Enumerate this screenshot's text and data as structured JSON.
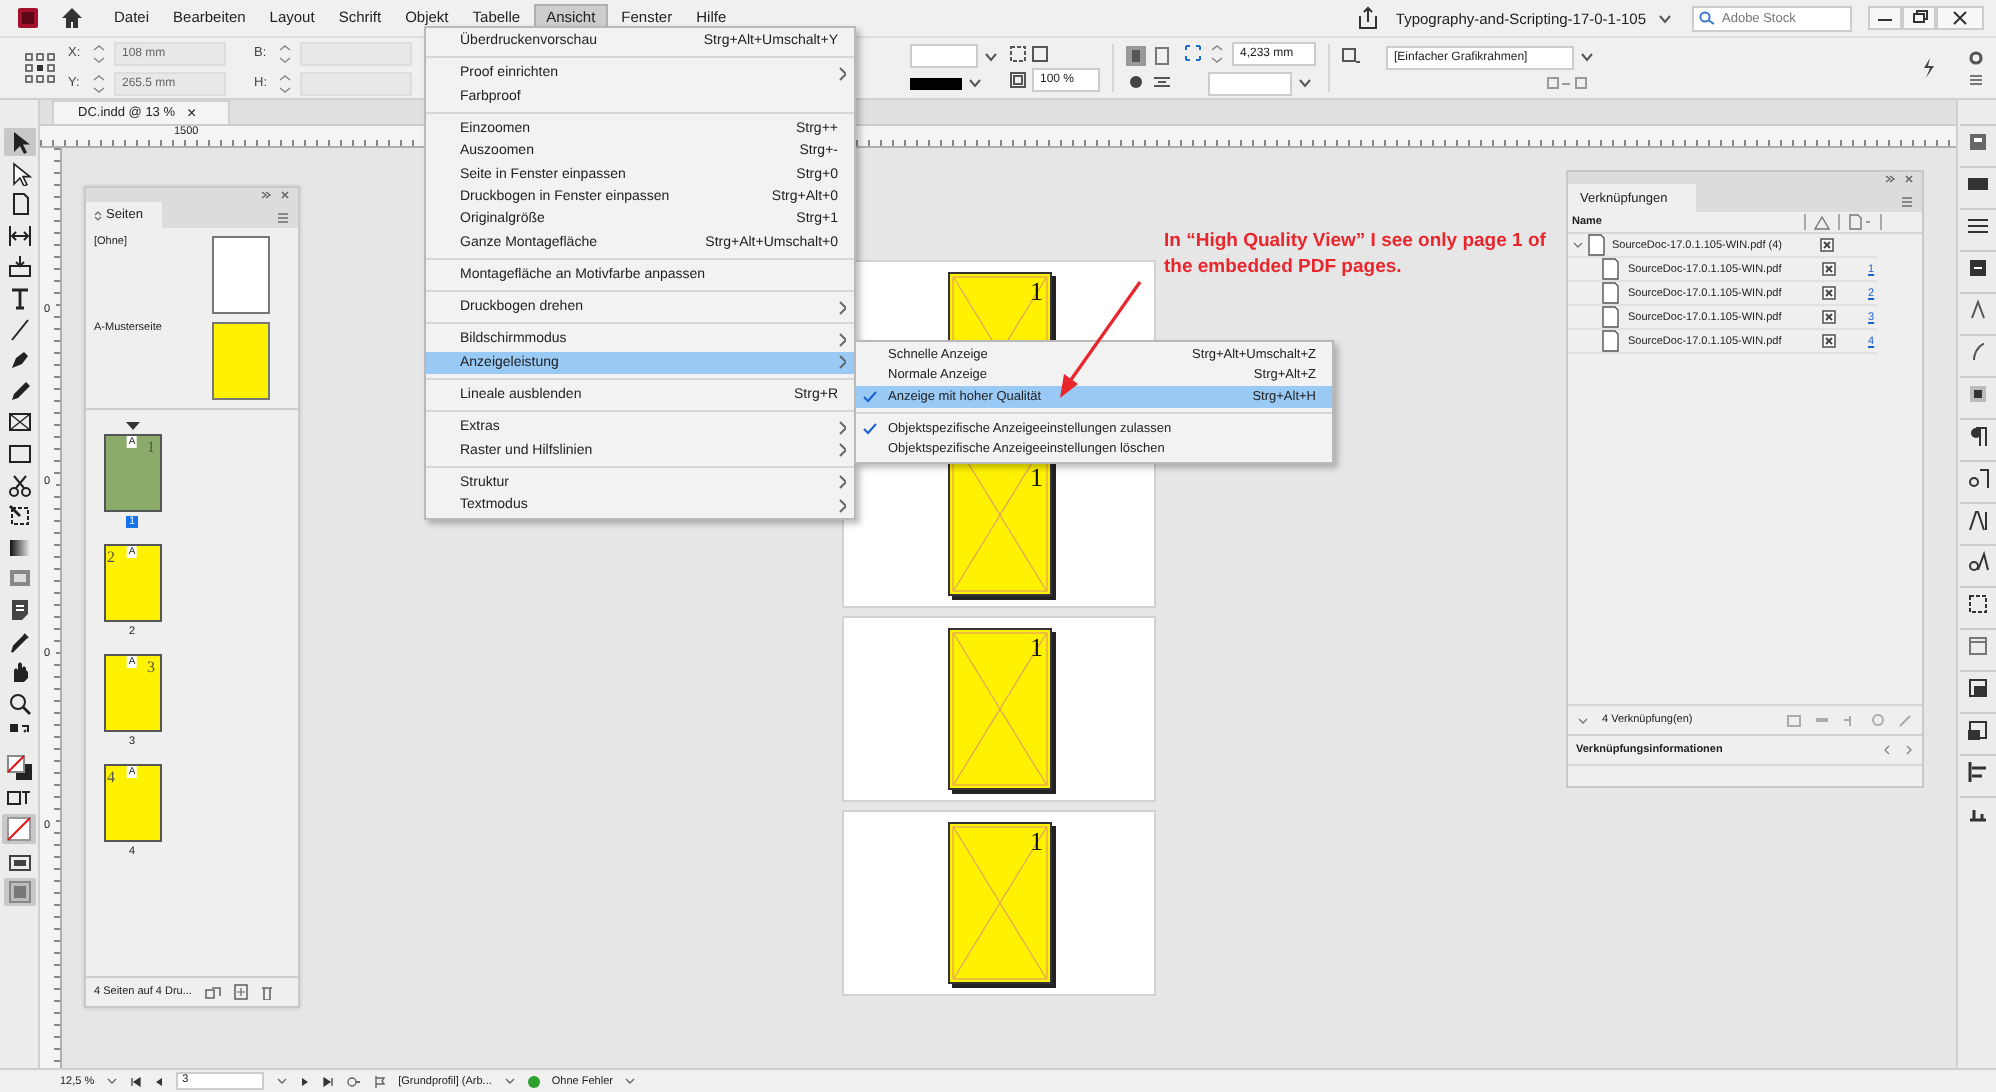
{
  "menubar": {
    "items": [
      {
        "label": "Datei",
        "selected": false
      },
      {
        "label": "Bearbeiten",
        "selected": false
      },
      {
        "label": "Layout",
        "selected": false
      },
      {
        "label": "Schrift",
        "selected": false
      },
      {
        "label": "Objekt",
        "selected": false
      },
      {
        "label": "Tabelle",
        "selected": false
      },
      {
        "label": "Ansicht",
        "selected": true
      },
      {
        "label": "Fenster",
        "selected": false
      },
      {
        "label": "Hilfe",
        "selected": false
      }
    ],
    "document_title": "Typography-and-Scripting-17-0-1-105",
    "search": {
      "placeholder": "Adobe Stock"
    }
  },
  "control_bar": {
    "x_label": "X:",
    "x_value": "108 mm",
    "y_label": "Y:",
    "y_value": "265.5 mm",
    "w_label": "B:",
    "h_label": "H:",
    "scale": "100 %",
    "stroke_weight": "4,233 mm",
    "object_style": "[Einfacher Grafikrahmen]"
  },
  "document_tab": {
    "title": "DC.indd @ 13 %",
    "close": "×"
  },
  "ruler": {
    "top_label": "1500",
    "left_labels": [
      "0",
      "0",
      "0",
      "0"
    ]
  },
  "canvas": {
    "pages": [
      {
        "numbers": [
          "1",
          "1"
        ]
      },
      {
        "numbers": [
          "1"
        ]
      },
      {
        "numbers": [
          "1"
        ]
      }
    ]
  },
  "pages_panel": {
    "title": "Seiten",
    "masters": [
      {
        "label": "[Ohne]",
        "color": "#ffffff"
      },
      {
        "label": "A-Musterseite",
        "color": "#fff200"
      }
    ],
    "pages": [
      {
        "label": "1",
        "master": "A",
        "thumb_number": "1",
        "number_left": false,
        "selected": true
      },
      {
        "label": "2",
        "master": "A",
        "thumb_number": "2",
        "number_left": true,
        "selected": false
      },
      {
        "label": "3",
        "master": "A",
        "thumb_number": "3",
        "number_left": false,
        "selected": false
      },
      {
        "label": "4",
        "master": "A",
        "thumb_number": "4",
        "number_left": true,
        "selected": false
      }
    ],
    "footer": "4 Seiten auf 4 Dru..."
  },
  "links_panel": {
    "title": "Verknüpfungen",
    "column": "Name",
    "parent": {
      "name": "SourceDoc-17.0.1.105-WIN.pdf (4)",
      "expanded": true,
      "children": [
        {
          "name": "SourceDoc-17.0.1.105-WIN.pdf",
          "page": "1"
        },
        {
          "name": "SourceDoc-17.0.1.105-WIN.pdf",
          "page": "2"
        },
        {
          "name": "SourceDoc-17.0.1.105-WIN.pdf",
          "page": "3"
        },
        {
          "name": "SourceDoc-17.0.1.105-WIN.pdf",
          "page": "4"
        }
      ]
    },
    "footer_count": "4 Verknüpfung(en)",
    "info_title": "Verknüpfungsinformationen"
  },
  "view_menu": {
    "groups": [
      [
        {
          "label": "Überdruckenvorschau",
          "shortcut": "Strg+Alt+Umschalt+Y",
          "submenu": false,
          "selected": false
        }
      ],
      [
        {
          "label": "Proof einrichten",
          "submenu": true,
          "selected": false
        },
        {
          "label": "Farbproof",
          "submenu": false,
          "selected": false
        }
      ],
      [
        {
          "label": "Einzoomen",
          "shortcut": "Strg++",
          "submenu": false,
          "selected": false
        },
        {
          "label": "Auszoomen",
          "shortcut": "Strg+-",
          "submenu": false,
          "selected": false
        },
        {
          "label": "Seite in Fenster einpassen",
          "shortcut": "Strg+0",
          "submenu": false,
          "selected": false
        },
        {
          "label": "Druckbogen in Fenster einpassen",
          "shortcut": "Strg+Alt+0",
          "submenu": false,
          "selected": false
        },
        {
          "label": "Originalgröße",
          "shortcut": "Strg+1",
          "submenu": false,
          "selected": false
        },
        {
          "label": "Ganze Montagefläche",
          "shortcut": "Strg+Alt+Umschalt+0",
          "submenu": false,
          "selected": false
        }
      ],
      [
        {
          "label": "Montagefläche an Motivfarbe anpassen",
          "submenu": false,
          "selected": false
        }
      ],
      [
        {
          "label": "Druckbogen drehen",
          "submenu": true,
          "selected": false
        }
      ],
      [
        {
          "label": "Bildschirmmodus",
          "submenu": true,
          "selected": false
        },
        {
          "label": "Anzeigeleistung",
          "submenu": true,
          "selected": true
        }
      ],
      [
        {
          "label": "Lineale ausblenden",
          "shortcut": "Strg+R",
          "submenu": false,
          "selected": false
        }
      ],
      [
        {
          "label": "Extras",
          "submenu": true,
          "selected": false
        },
        {
          "label": "Raster und Hilfslinien",
          "submenu": true,
          "selected": false
        }
      ],
      [
        {
          "label": "Struktur",
          "submenu": true,
          "selected": false
        },
        {
          "label": "Textmodus",
          "submenu": true,
          "selected": false
        }
      ]
    ]
  },
  "display_submenu": {
    "groups": [
      [
        {
          "label": "Schnelle Anzeige",
          "shortcut": "Strg+Alt+Umschalt+Z",
          "checked": false,
          "selected": false
        },
        {
          "label": "Normale Anzeige",
          "shortcut": "Strg+Alt+Z",
          "checked": false,
          "selected": false
        },
        {
          "label": "Anzeige mit hoher Qualität",
          "shortcut": "Strg+Alt+H",
          "checked": true,
          "selected": true
        }
      ],
      [
        {
          "label": "Objektspezifische Anzeigeeinstellungen zulassen",
          "checked": true,
          "selected": false
        },
        {
          "label": "Objektspezifische Anzeigeeinstellungen löschen",
          "checked": false,
          "selected": false
        }
      ]
    ]
  },
  "annotation": {
    "text": "In “High Quality View” I see only page 1 of the embedded PDF pages."
  },
  "status_bar": {
    "zoom": "12,5 %",
    "page": "3",
    "profile": "[Grundprofil] (Arb...",
    "preflight": "Ohne Fehler"
  }
}
